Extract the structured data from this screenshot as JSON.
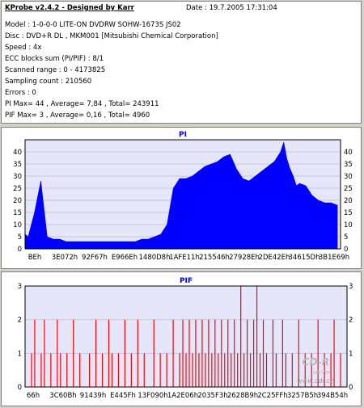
{
  "info": {
    "title": "KProbe v2.4.2 - Designed by Karr",
    "date": "Date : 19.7.2005 17:31:04",
    "lines": [
      "Model : 1-0-0-0 LITE-ON DVDRW SOHW-1673S JS02",
      "Disc : DVD+R DL , MKM001 [Mitsubishi Chemical Corporation]",
      "Speed : 4x",
      "ECC blocks sum (PI/PIF) : 8/1",
      "Scanned range : 0 - 4173825",
      "Sampling count : 210560",
      "Errors : 0",
      "PI Max= 44 , Average= 7,84 , Total= 243911",
      "PIF Max= 3 , Average= 0,16 , Total= 4960"
    ]
  },
  "colors": {
    "pi": "#0000ff",
    "pif": "#ff0000",
    "bg": "#e6e6fa",
    "title": "#0000ff"
  },
  "chart_data": [
    {
      "type": "area",
      "title": "PI",
      "ylim": [
        0,
        45
      ],
      "yticks": [
        0,
        5,
        10,
        15,
        20,
        25,
        30,
        35,
        40
      ],
      "xticks": [
        "BEh",
        "3E072h",
        "92F67h",
        "E966Eh",
        "1480D8h",
        "1AFE11h",
        "215546h",
        "27928Eh",
        "2DE42Eh",
        "34615Dh",
        "3B1E69h"
      ],
      "x": [
        0,
        1,
        3,
        5,
        7,
        9,
        11,
        13,
        15,
        17,
        19,
        21,
        23,
        25,
        27,
        29,
        31,
        33,
        35,
        37,
        39,
        41,
        43,
        45,
        47,
        49,
        51,
        53,
        55,
        57,
        59,
        61,
        63,
        65,
        67,
        69,
        71,
        73,
        75,
        77,
        79,
        80,
        81,
        82,
        83,
        84,
        85,
        86,
        87,
        89,
        91,
        93,
        95,
        97,
        99
      ],
      "y": [
        6,
        5,
        15,
        28,
        5,
        4,
        4,
        3,
        3,
        3,
        3,
        3,
        3,
        3,
        3,
        3,
        3,
        3,
        3,
        4,
        4,
        5,
        6,
        10,
        25,
        29,
        29,
        30,
        32,
        34,
        35,
        36,
        38,
        39,
        33,
        29,
        28,
        30,
        32,
        34,
        36,
        38,
        40,
        44,
        37,
        33,
        30,
        26,
        27,
        26,
        22,
        20,
        19,
        19,
        18
      ],
      "series": [
        {
          "values": [
            6,
            5,
            15,
            28,
            5,
            4,
            4,
            3,
            3,
            3,
            3,
            3,
            3,
            3,
            3,
            3,
            3,
            3,
            3,
            4,
            4,
            5,
            6,
            10,
            25,
            29,
            29,
            30,
            32,
            34,
            35,
            36,
            38,
            39,
            33,
            29,
            28,
            30,
            32,
            34,
            36,
            38,
            40,
            44,
            37,
            33,
            30,
            26,
            27,
            26,
            22,
            20,
            19,
            19,
            18
          ]
        }
      ],
      "grid": true
    },
    {
      "type": "bar",
      "title": "PIF",
      "ylim": [
        0,
        3
      ],
      "yticks": [
        0,
        1,
        2,
        3
      ],
      "xticks": [
        "66h",
        "3C60Bh",
        "91439h",
        "E445Fh",
        "13F090h",
        "1A2E06h",
        "2035F3h",
        "2628B9h",
        "2C25FFh",
        "3257B5h",
        "394B54h"
      ],
      "spikes": [
        [
          2,
          1
        ],
        [
          3,
          2
        ],
        [
          5,
          1
        ],
        [
          6,
          2
        ],
        [
          8,
          1
        ],
        [
          10,
          2
        ],
        [
          11,
          1
        ],
        [
          13,
          1
        ],
        [
          15,
          2
        ],
        [
          17,
          1
        ],
        [
          20,
          1
        ],
        [
          22,
          2
        ],
        [
          24,
          1
        ],
        [
          26,
          2
        ],
        [
          27,
          1
        ],
        [
          29,
          1
        ],
        [
          31,
          2
        ],
        [
          33,
          1
        ],
        [
          35,
          2
        ],
        [
          37,
          1
        ],
        [
          40,
          2
        ],
        [
          42,
          1
        ],
        [
          44,
          1
        ],
        [
          46,
          2
        ],
        [
          48,
          1
        ],
        [
          49,
          2
        ],
        [
          50,
          1
        ],
        [
          51,
          2
        ],
        [
          52,
          1
        ],
        [
          53,
          2
        ],
        [
          54,
          1
        ],
        [
          55,
          2
        ],
        [
          56,
          1
        ],
        [
          57,
          2
        ],
        [
          58,
          1
        ],
        [
          59,
          2
        ],
        [
          60,
          1
        ],
        [
          61,
          2
        ],
        [
          62,
          1
        ],
        [
          63,
          2
        ],
        [
          64,
          1
        ],
        [
          65,
          2
        ],
        [
          66,
          1
        ],
        [
          67,
          3
        ],
        [
          68,
          1
        ],
        [
          69,
          2
        ],
        [
          70,
          1
        ],
        [
          71,
          2
        ],
        [
          72,
          3
        ],
        [
          73,
          1
        ],
        [
          74,
          2
        ],
        [
          75,
          1
        ],
        [
          77,
          2
        ],
        [
          78,
          1
        ],
        [
          80,
          2
        ],
        [
          81,
          1
        ],
        [
          83,
          1
        ],
        [
          85,
          2
        ],
        [
          87,
          1
        ],
        [
          89,
          1
        ],
        [
          91,
          2
        ],
        [
          93,
          1
        ],
        [
          95,
          1
        ],
        [
          96,
          2
        ],
        [
          98,
          1
        ]
      ],
      "grid": true
    }
  ],
  "watermark": {
    "logo": "CD-R",
    "sub": "server",
    "url": "www.cdr.cz"
  }
}
